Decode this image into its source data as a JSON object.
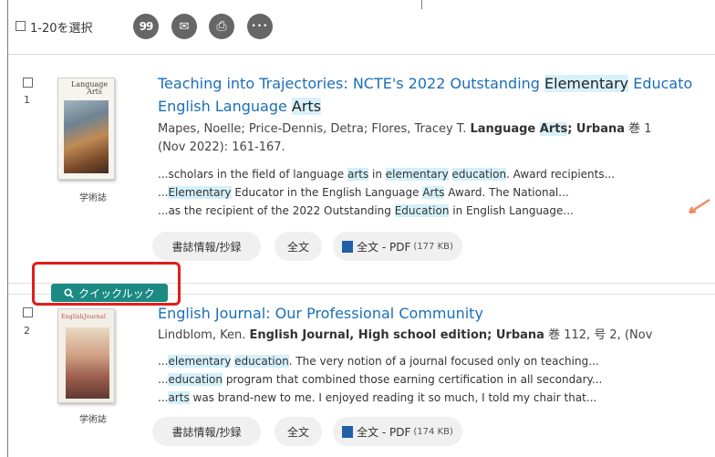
{
  "toolbar": {
    "select_label": "1-20を選択",
    "buttons": [
      {
        "icon": "quote-icon",
        "glyph": "99"
      },
      {
        "icon": "email-icon",
        "glyph": "✉"
      },
      {
        "icon": "print-icon",
        "glyph": "⎙"
      },
      {
        "icon": "more-icon",
        "glyph": "•••"
      }
    ]
  },
  "results": [
    {
      "number": "1",
      "doctype": "学術誌",
      "cover_title": "Language Arts",
      "title_line1": [
        "Teaching into Trajectories: NCTE's 2022 Outstanding ",
        "Elementary",
        " Educato"
      ],
      "title_line2": [
        "English Language ",
        "Arts"
      ],
      "meta_line1": [
        "Mapes, Noelle; Price-Dennis, Detra; Flores, Tracey T. ",
        "Language ",
        "Arts",
        "; Urbana",
        " 巻 1"
      ],
      "meta_line2": "(Nov 2022): 161-167.",
      "snippets": [
        [
          "...scholars in the field of language ",
          "arts",
          " in ",
          "elementary",
          " ",
          "education",
          ". Award recipients..."
        ],
        [
          "...",
          "Elementary",
          " Educator in the English Language ",
          "Arts",
          " Award. The National..."
        ],
        [
          "...as the recipient of the 2022 Outstanding ",
          "Education",
          " in English Language..."
        ]
      ],
      "links": {
        "abstract": "書誌情報/抄録",
        "fulltext": "全文",
        "pdf": "全文 - PDF",
        "pdf_size": "(177 KB)"
      }
    },
    {
      "number": "2",
      "doctype": "学術誌",
      "cover_title": "EnglishJournal",
      "title": "English Journal: Our Professional Community",
      "meta_line1": [
        "Lindblom, Ken. ",
        "English Journal, High school edition; Urbana",
        " 巻 112, 号 2,  (Nov"
      ],
      "snippets": [
        [
          "...",
          "elementary",
          " ",
          "education",
          ". The very notion of a journal focused only on teaching..."
        ],
        [
          "...",
          "education",
          " program that combined those earning certification in all secondary..."
        ],
        [
          "...",
          "arts",
          " was brand-new to me. I enjoyed reading it so much, I told my chair that..."
        ]
      ],
      "links": {
        "abstract": "書誌情報/抄録",
        "fulltext": "全文",
        "pdf": "全文 - PDF",
        "pdf_size": "(174 KB)"
      }
    }
  ],
  "quicklook": {
    "label": "クイックルック"
  },
  "colors": {
    "link": "#1a6fb8",
    "highlight": "#d8f1fb",
    "quicklook": "#1a8a83",
    "callout": "#e21c1c",
    "arrow": "#f08a5d"
  }
}
